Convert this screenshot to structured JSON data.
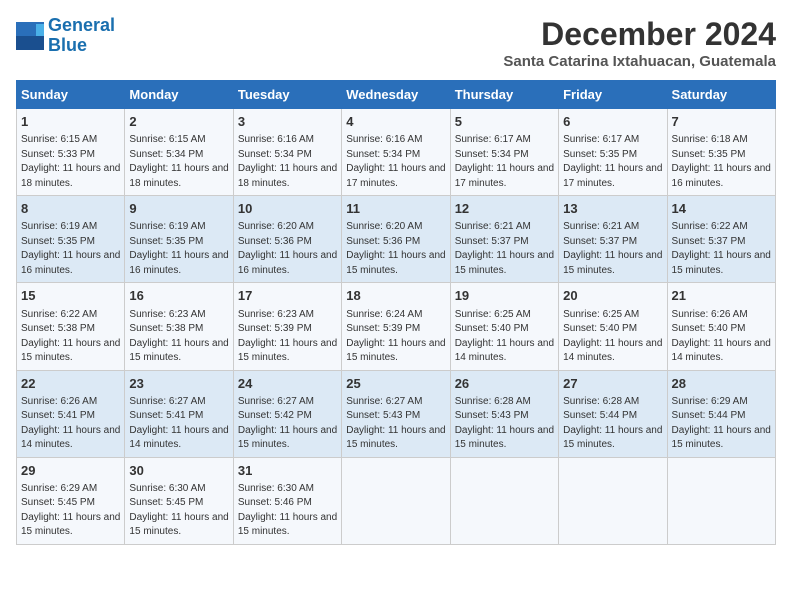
{
  "header": {
    "logo_line1": "General",
    "logo_line2": "Blue",
    "month_title": "December 2024",
    "subtitle": "Santa Catarina Ixtahuacan, Guatemala"
  },
  "days_of_week": [
    "Sunday",
    "Monday",
    "Tuesday",
    "Wednesday",
    "Thursday",
    "Friday",
    "Saturday"
  ],
  "weeks": [
    [
      {
        "day": 1,
        "rise": "6:15 AM",
        "set": "5:33 PM",
        "daylight": "11 hours and 18 minutes."
      },
      {
        "day": 2,
        "rise": "6:15 AM",
        "set": "5:34 PM",
        "daylight": "11 hours and 18 minutes."
      },
      {
        "day": 3,
        "rise": "6:16 AM",
        "set": "5:34 PM",
        "daylight": "11 hours and 18 minutes."
      },
      {
        "day": 4,
        "rise": "6:16 AM",
        "set": "5:34 PM",
        "daylight": "11 hours and 17 minutes."
      },
      {
        "day": 5,
        "rise": "6:17 AM",
        "set": "5:34 PM",
        "daylight": "11 hours and 17 minutes."
      },
      {
        "day": 6,
        "rise": "6:17 AM",
        "set": "5:35 PM",
        "daylight": "11 hours and 17 minutes."
      },
      {
        "day": 7,
        "rise": "6:18 AM",
        "set": "5:35 PM",
        "daylight": "11 hours and 16 minutes."
      }
    ],
    [
      {
        "day": 8,
        "rise": "6:19 AM",
        "set": "5:35 PM",
        "daylight": "11 hours and 16 minutes."
      },
      {
        "day": 9,
        "rise": "6:19 AM",
        "set": "5:35 PM",
        "daylight": "11 hours and 16 minutes."
      },
      {
        "day": 10,
        "rise": "6:20 AM",
        "set": "5:36 PM",
        "daylight": "11 hours and 16 minutes."
      },
      {
        "day": 11,
        "rise": "6:20 AM",
        "set": "5:36 PM",
        "daylight": "11 hours and 15 minutes."
      },
      {
        "day": 12,
        "rise": "6:21 AM",
        "set": "5:37 PM",
        "daylight": "11 hours and 15 minutes."
      },
      {
        "day": 13,
        "rise": "6:21 AM",
        "set": "5:37 PM",
        "daylight": "11 hours and 15 minutes."
      },
      {
        "day": 14,
        "rise": "6:22 AM",
        "set": "5:37 PM",
        "daylight": "11 hours and 15 minutes."
      }
    ],
    [
      {
        "day": 15,
        "rise": "6:22 AM",
        "set": "5:38 PM",
        "daylight": "11 hours and 15 minutes."
      },
      {
        "day": 16,
        "rise": "6:23 AM",
        "set": "5:38 PM",
        "daylight": "11 hours and 15 minutes."
      },
      {
        "day": 17,
        "rise": "6:23 AM",
        "set": "5:39 PM",
        "daylight": "11 hours and 15 minutes."
      },
      {
        "day": 18,
        "rise": "6:24 AM",
        "set": "5:39 PM",
        "daylight": "11 hours and 15 minutes."
      },
      {
        "day": 19,
        "rise": "6:25 AM",
        "set": "5:40 PM",
        "daylight": "11 hours and 14 minutes."
      },
      {
        "day": 20,
        "rise": "6:25 AM",
        "set": "5:40 PM",
        "daylight": "11 hours and 14 minutes."
      },
      {
        "day": 21,
        "rise": "6:26 AM",
        "set": "5:40 PM",
        "daylight": "11 hours and 14 minutes."
      }
    ],
    [
      {
        "day": 22,
        "rise": "6:26 AM",
        "set": "5:41 PM",
        "daylight": "11 hours and 14 minutes."
      },
      {
        "day": 23,
        "rise": "6:27 AM",
        "set": "5:41 PM",
        "daylight": "11 hours and 14 minutes."
      },
      {
        "day": 24,
        "rise": "6:27 AM",
        "set": "5:42 PM",
        "daylight": "11 hours and 15 minutes."
      },
      {
        "day": 25,
        "rise": "6:27 AM",
        "set": "5:43 PM",
        "daylight": "11 hours and 15 minutes."
      },
      {
        "day": 26,
        "rise": "6:28 AM",
        "set": "5:43 PM",
        "daylight": "11 hours and 15 minutes."
      },
      {
        "day": 27,
        "rise": "6:28 AM",
        "set": "5:44 PM",
        "daylight": "11 hours and 15 minutes."
      },
      {
        "day": 28,
        "rise": "6:29 AM",
        "set": "5:44 PM",
        "daylight": "11 hours and 15 minutes."
      }
    ],
    [
      {
        "day": 29,
        "rise": "6:29 AM",
        "set": "5:45 PM",
        "daylight": "11 hours and 15 minutes."
      },
      {
        "day": 30,
        "rise": "6:30 AM",
        "set": "5:45 PM",
        "daylight": "11 hours and 15 minutes."
      },
      {
        "day": 31,
        "rise": "6:30 AM",
        "set": "5:46 PM",
        "daylight": "11 hours and 15 minutes."
      },
      null,
      null,
      null,
      null
    ]
  ]
}
